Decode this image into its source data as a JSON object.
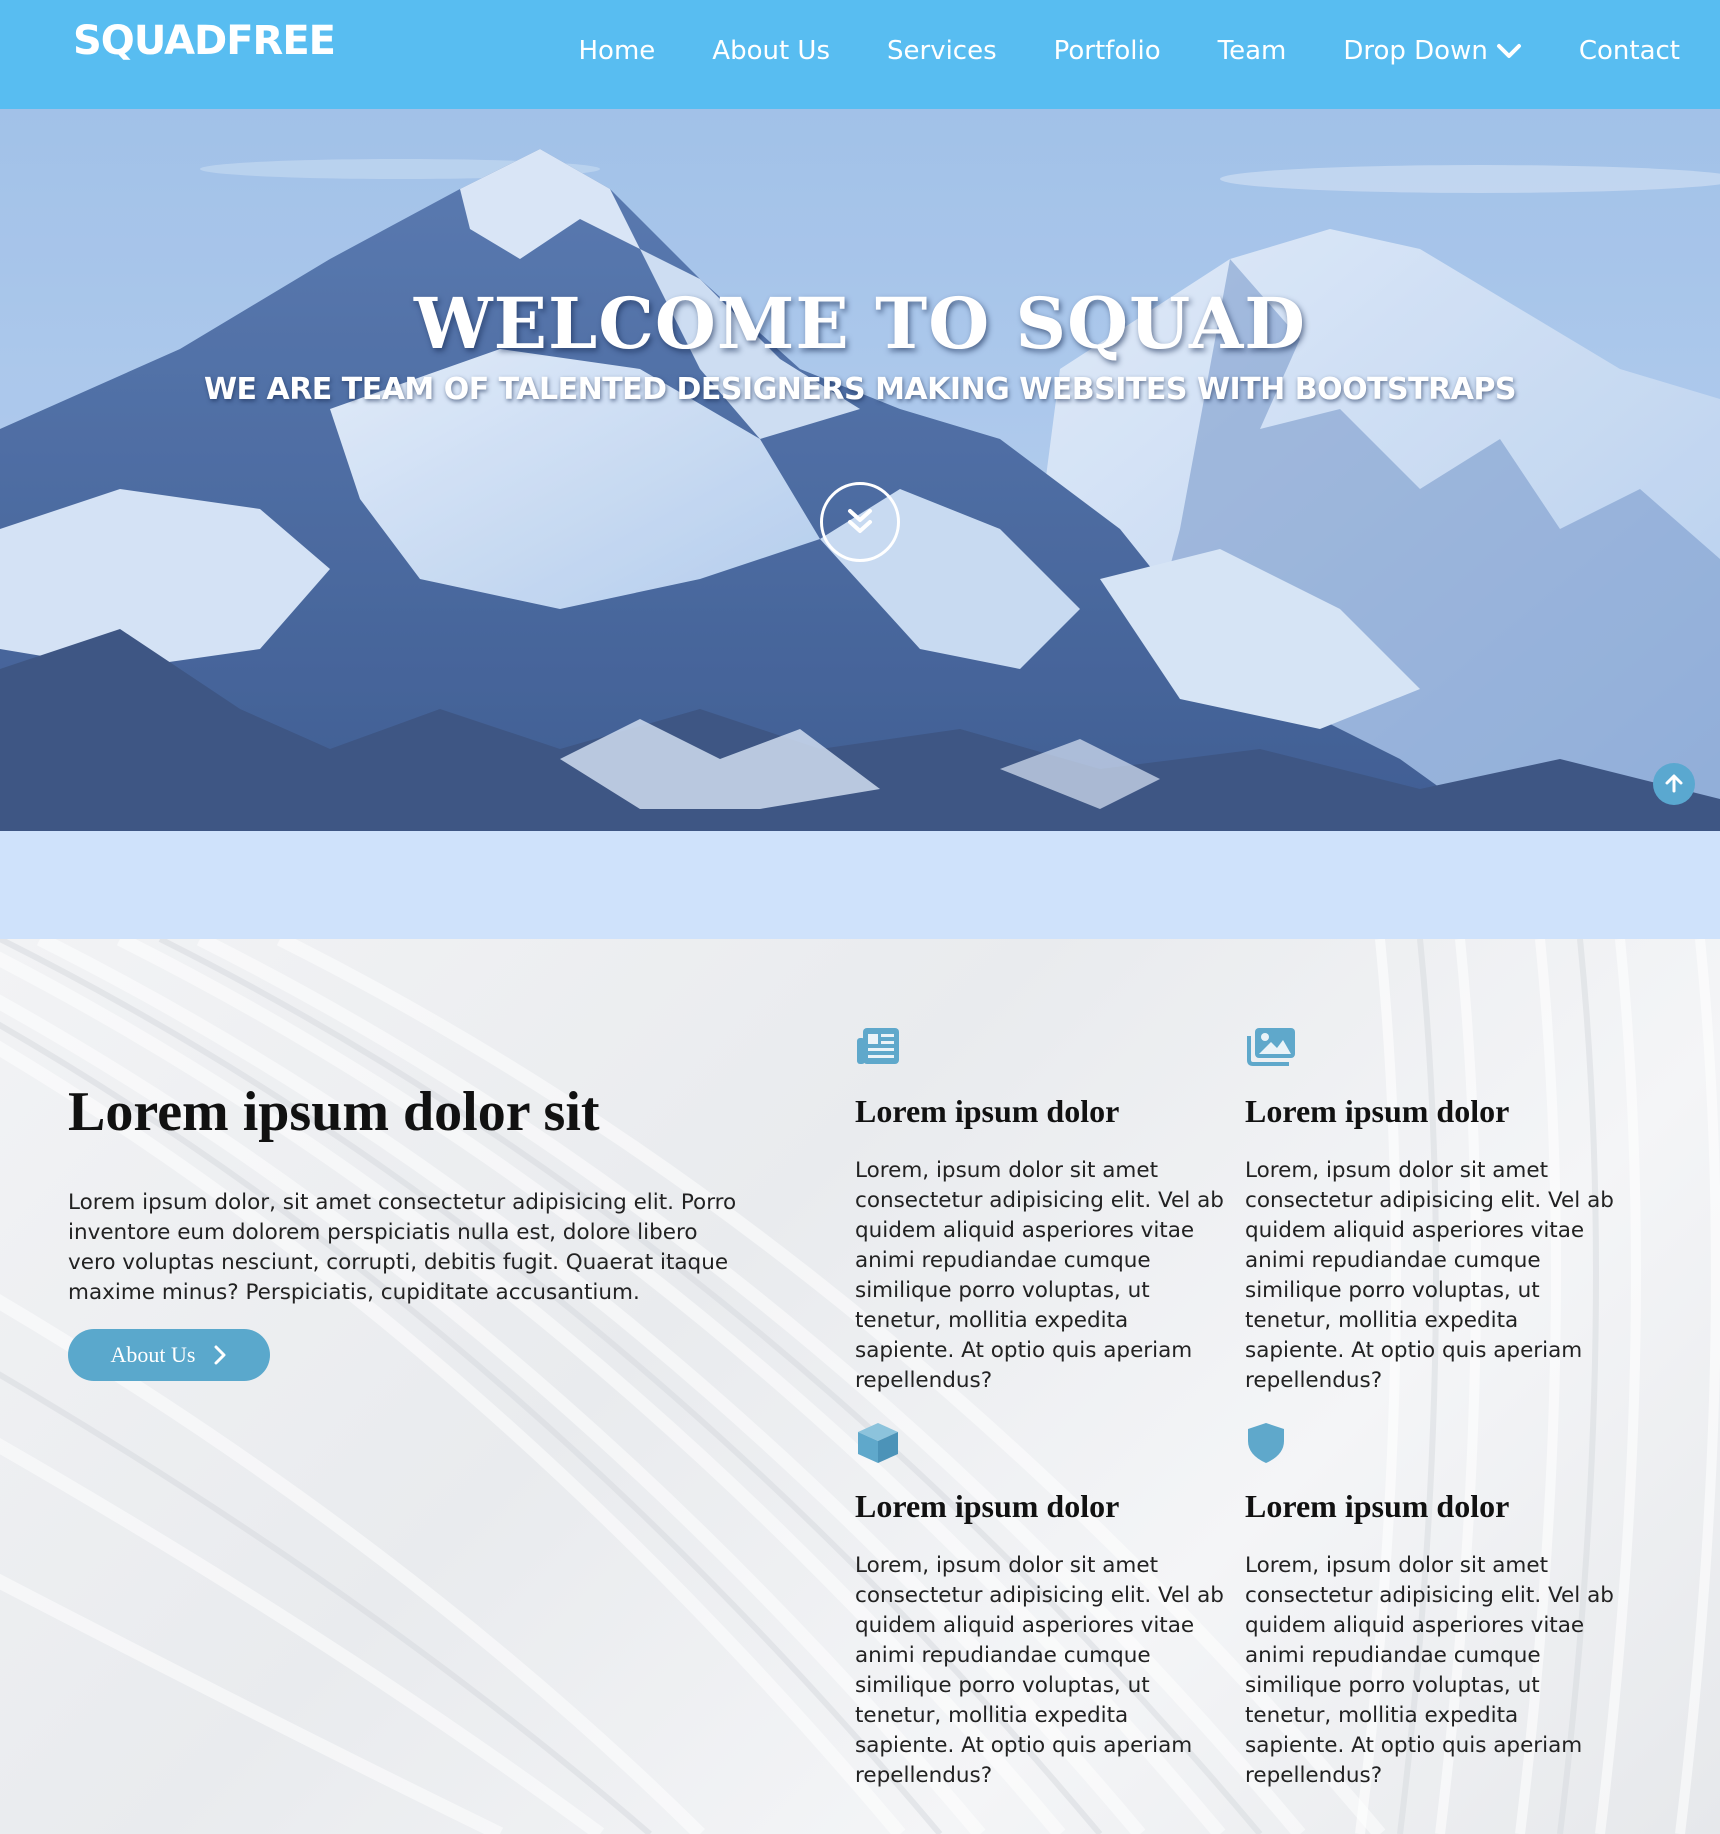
{
  "brand": "SQUADFREE",
  "nav": {
    "items": [
      "Home",
      "About Us",
      "Services",
      "Portfolio",
      "Team",
      "Drop Down",
      "Contact"
    ]
  },
  "hero": {
    "title": "WELCOME TO SQUAD",
    "subtitle": "WE ARE TEAM OF TALENTED DESIGNERS MAKING WEBSITES WITH BOOTSTRAPS"
  },
  "intro": {
    "title": "Lorem ipsum dolor sit",
    "text": "Lorem ipsum dolor, sit amet consectetur adipisicing elit. Porro inventore eum dolorem perspiciatis nulla est, dolore libero vero voluptas nesciunt, corrupti, debitis fugit. Quaerat itaque maxime minus? Perspiciatis, cupiditate accusantium.",
    "button_label": "About Us"
  },
  "cards": [
    {
      "icon": "newspaper-icon",
      "title": "Lorem ipsum dolor",
      "text": "Lorem, ipsum dolor sit amet consectetur adipisicing elit. Vel ab quidem aliquid asperiores vitae animi repudiandae cumque similique porro voluptas, ut tenetur, mollitia expedita sapiente. At optio quis aperiam repellendus?"
    },
    {
      "icon": "images-icon",
      "title": "Lorem ipsum dolor",
      "text": "Lorem, ipsum dolor sit amet consectetur adipisicing elit. Vel ab quidem aliquid asperiores vitae animi repudiandae cumque similique porro voluptas, ut tenetur, mollitia expedita sapiente. At optio quis aperiam repellendus?"
    },
    {
      "icon": "cube-icon",
      "title": "Lorem ipsum dolor",
      "text": "Lorem, ipsum dolor sit amet consectetur adipisicing elit. Vel ab quidem aliquid asperiores vitae animi repudiandae cumque similique porro voluptas, ut tenetur, mollitia expedita sapiente. At optio quis aperiam repellendus?"
    },
    {
      "icon": "shield-icon",
      "title": "Lorem ipsum dolor",
      "text": "Lorem, ipsum dolor sit amet consectetur adipisicing elit. Vel ab quidem aliquid asperiores vitae animi repudiandae cumque similique porro voluptas, ut tenetur, mollitia expedita sapiente. At optio quis aperiam repellendus?"
    }
  ],
  "colors": {
    "navbar": "#58bdf1",
    "band": "#cfe2fb",
    "accent": "#5aa8cc",
    "icon": "#5fa8cb"
  }
}
